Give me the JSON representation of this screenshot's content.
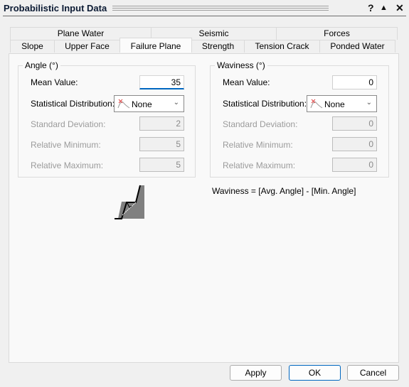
{
  "window": {
    "title": "Probabilistic Input Data",
    "help_label": "?",
    "collapse_label": "▲",
    "close_label": "✕"
  },
  "tabs": {
    "back_row": [
      {
        "label": "Plane Water"
      },
      {
        "label": "Seismic"
      },
      {
        "label": "Forces"
      }
    ],
    "front_row": [
      {
        "label": "Slope"
      },
      {
        "label": "Upper Face"
      },
      {
        "label": "Failure Plane",
        "active": true
      },
      {
        "label": "Strength"
      },
      {
        "label": "Tension Crack"
      },
      {
        "label": "Ponded Water"
      }
    ]
  },
  "angle_group": {
    "title": "Angle (°)",
    "mean_label": "Mean Value:",
    "mean_value": "35",
    "dist_label": "Statistical Distribution:",
    "dist_value": "None",
    "std_label": "Standard Deviation:",
    "std_value": "2",
    "relmin_label": "Relative Minimum:",
    "relmin_value": "5",
    "relmax_label": "Relative Maximum:",
    "relmax_value": "5"
  },
  "waviness_group": {
    "title": "Waviness (°)",
    "mean_label": "Mean Value:",
    "mean_value": "0",
    "dist_label": "Statistical Distribution:",
    "dist_value": "None",
    "std_label": "Standard Deviation:",
    "std_value": "0",
    "relmin_label": "Relative Minimum:",
    "relmin_value": "0",
    "relmax_label": "Relative Maximum:",
    "relmax_value": "0"
  },
  "formula_text": "Waviness = [Avg. Angle] - [Min. Angle]",
  "buttons": {
    "apply": "Apply",
    "ok": "OK",
    "cancel": "Cancel"
  },
  "colors": {
    "focus_accent": "#0067c0",
    "slope_fill": "#808080"
  }
}
